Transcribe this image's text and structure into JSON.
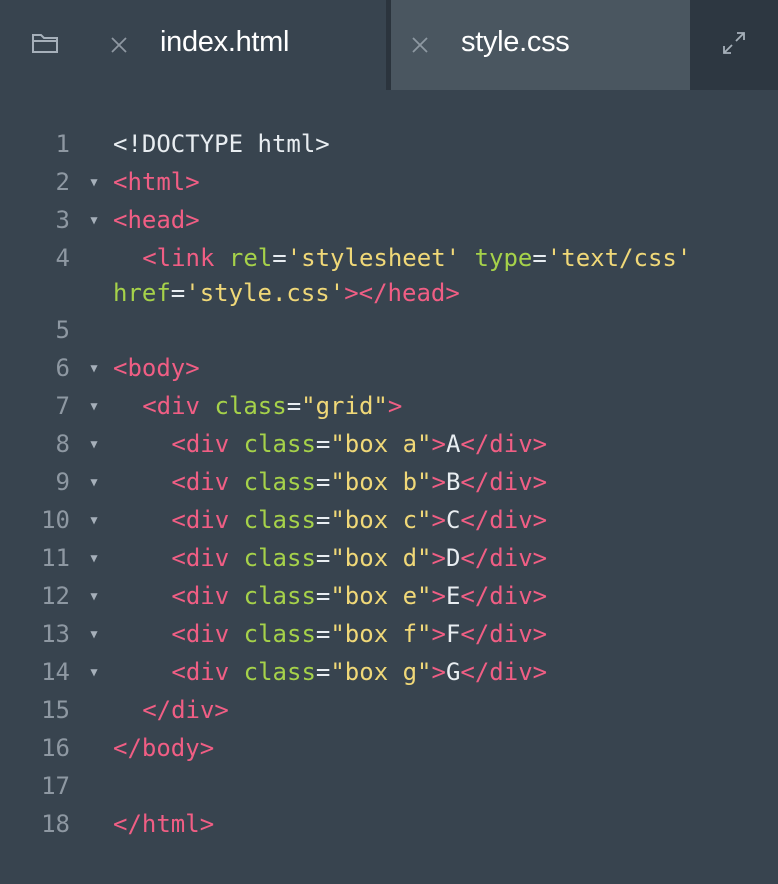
{
  "tabs": {
    "folder_icon": "folder-icon",
    "items": [
      {
        "label": "index.html",
        "active": true
      },
      {
        "label": "style.css",
        "active": false
      }
    ],
    "expand_icon": "expand-icon"
  },
  "colors": {
    "background": "#38444f",
    "tag": "#f05e84",
    "attribute": "#a6d24a",
    "string": "#f0d878",
    "text": "#e8edf1",
    "line_number": "#8e98a2"
  },
  "editor": {
    "lines": [
      {
        "num": "1",
        "fold": false,
        "indent": 0,
        "tokens": [
          [
            "txt",
            "<!DOCTYPE html>"
          ]
        ]
      },
      {
        "num": "2",
        "fold": true,
        "indent": 0,
        "tokens": [
          [
            "tag",
            "<html>"
          ]
        ]
      },
      {
        "num": "3",
        "fold": true,
        "indent": 0,
        "tokens": [
          [
            "tag",
            "<head>"
          ]
        ]
      },
      {
        "num": "4",
        "fold": false,
        "indent": 1,
        "tokens": [
          [
            "tag",
            "<link"
          ],
          [
            "txt",
            " "
          ],
          [
            "attr",
            "rel"
          ],
          [
            "txt",
            "="
          ],
          [
            "str",
            "'stylesheet'"
          ],
          [
            "txt",
            " "
          ],
          [
            "attr",
            "type"
          ],
          [
            "txt",
            "="
          ],
          [
            "str",
            "'text/css'"
          ]
        ]
      },
      {
        "num": "",
        "fold": false,
        "indent": 0,
        "tokens": [
          [
            "attr",
            "href"
          ],
          [
            "txt",
            "="
          ],
          [
            "str",
            "'style.css'"
          ],
          [
            "tag",
            "></head>"
          ]
        ]
      },
      {
        "num": "5",
        "fold": false,
        "indent": 0,
        "tokens": []
      },
      {
        "num": "6",
        "fold": true,
        "indent": 0,
        "tokens": [
          [
            "tag",
            "<body>"
          ]
        ]
      },
      {
        "num": "7",
        "fold": true,
        "indent": 1,
        "tokens": [
          [
            "tag",
            "<div"
          ],
          [
            "txt",
            " "
          ],
          [
            "attr",
            "class"
          ],
          [
            "txt",
            "="
          ],
          [
            "str",
            "\"grid\""
          ],
          [
            "tag",
            ">"
          ]
        ]
      },
      {
        "num": "8",
        "fold": true,
        "indent": 2,
        "tokens": [
          [
            "tag",
            "<div"
          ],
          [
            "txt",
            " "
          ],
          [
            "attr",
            "class"
          ],
          [
            "txt",
            "="
          ],
          [
            "str",
            "\"box a\""
          ],
          [
            "tag",
            ">"
          ],
          [
            "txt",
            "A"
          ],
          [
            "tag",
            "</div>"
          ]
        ]
      },
      {
        "num": "9",
        "fold": true,
        "indent": 2,
        "tokens": [
          [
            "tag",
            "<div"
          ],
          [
            "txt",
            " "
          ],
          [
            "attr",
            "class"
          ],
          [
            "txt",
            "="
          ],
          [
            "str",
            "\"box b\""
          ],
          [
            "tag",
            ">"
          ],
          [
            "txt",
            "B"
          ],
          [
            "tag",
            "</div>"
          ]
        ]
      },
      {
        "num": "10",
        "fold": true,
        "indent": 2,
        "tokens": [
          [
            "tag",
            "<div"
          ],
          [
            "txt",
            " "
          ],
          [
            "attr",
            "class"
          ],
          [
            "txt",
            "="
          ],
          [
            "str",
            "\"box c\""
          ],
          [
            "tag",
            ">"
          ],
          [
            "txt",
            "C"
          ],
          [
            "tag",
            "</div>"
          ]
        ]
      },
      {
        "num": "11",
        "fold": true,
        "indent": 2,
        "tokens": [
          [
            "tag",
            "<div"
          ],
          [
            "txt",
            " "
          ],
          [
            "attr",
            "class"
          ],
          [
            "txt",
            "="
          ],
          [
            "str",
            "\"box d\""
          ],
          [
            "tag",
            ">"
          ],
          [
            "txt",
            "D"
          ],
          [
            "tag",
            "</div>"
          ]
        ]
      },
      {
        "num": "12",
        "fold": true,
        "indent": 2,
        "tokens": [
          [
            "tag",
            "<div"
          ],
          [
            "txt",
            " "
          ],
          [
            "attr",
            "class"
          ],
          [
            "txt",
            "="
          ],
          [
            "str",
            "\"box e\""
          ],
          [
            "tag",
            ">"
          ],
          [
            "txt",
            "E"
          ],
          [
            "tag",
            "</div>"
          ]
        ]
      },
      {
        "num": "13",
        "fold": true,
        "indent": 2,
        "tokens": [
          [
            "tag",
            "<div"
          ],
          [
            "txt",
            " "
          ],
          [
            "attr",
            "class"
          ],
          [
            "txt",
            "="
          ],
          [
            "str",
            "\"box f\""
          ],
          [
            "tag",
            ">"
          ],
          [
            "txt",
            "F"
          ],
          [
            "tag",
            "</div>"
          ]
        ]
      },
      {
        "num": "14",
        "fold": true,
        "indent": 2,
        "tokens": [
          [
            "tag",
            "<div"
          ],
          [
            "txt",
            " "
          ],
          [
            "attr",
            "class"
          ],
          [
            "txt",
            "="
          ],
          [
            "str",
            "\"box g\""
          ],
          [
            "tag",
            ">"
          ],
          [
            "txt",
            "G"
          ],
          [
            "tag",
            "</div>"
          ]
        ]
      },
      {
        "num": "15",
        "fold": false,
        "indent": 1,
        "tokens": [
          [
            "tag",
            "</div>"
          ]
        ]
      },
      {
        "num": "16",
        "fold": false,
        "indent": 0,
        "tokens": [
          [
            "tag",
            "</body>"
          ]
        ]
      },
      {
        "num": "17",
        "fold": false,
        "indent": 0,
        "tokens": []
      },
      {
        "num": "18",
        "fold": false,
        "indent": 0,
        "tokens": [
          [
            "tag",
            "</html>"
          ]
        ]
      }
    ]
  }
}
